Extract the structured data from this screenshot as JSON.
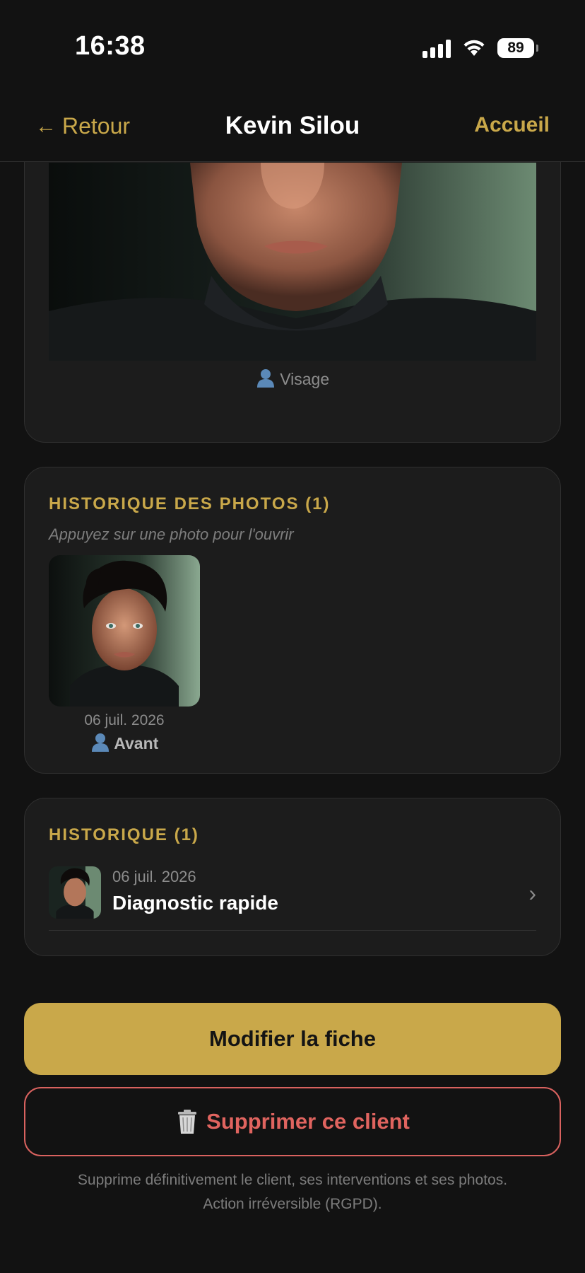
{
  "status_bar": {
    "time": "16:38",
    "battery": "89"
  },
  "nav": {
    "back_label": "Retour",
    "title": "Kevin Silou",
    "home_label": "Accueil"
  },
  "main_photo": {
    "caption": "Visage"
  },
  "photo_history": {
    "title": "HISTORIQUE DES PHOTOS (1)",
    "hint": "Appuyez sur une photo pour l'ouvrir",
    "items": [
      {
        "date": "06 juil. 2026",
        "tag": "Avant"
      }
    ]
  },
  "history": {
    "title": "HISTORIQUE (1)",
    "items": [
      {
        "date": "06 juil. 2026",
        "title": "Diagnostic rapide"
      }
    ]
  },
  "actions": {
    "edit_label": "Modifier la fiche",
    "delete_label": "Supprimer ce client",
    "warning_line1": "Supprime définitivement le client, ses interventions et ses photos.",
    "warning_line2": "Action irréversible (RGPD)."
  },
  "colors": {
    "accent": "#c9a84a",
    "danger": "#e0645f",
    "background": "#121212",
    "card": "#1c1c1c"
  },
  "icons": [
    "signal-icon",
    "wifi-icon",
    "battery-icon",
    "back-arrow-icon",
    "person-icon",
    "chevron-right-icon",
    "trash-icon"
  ]
}
